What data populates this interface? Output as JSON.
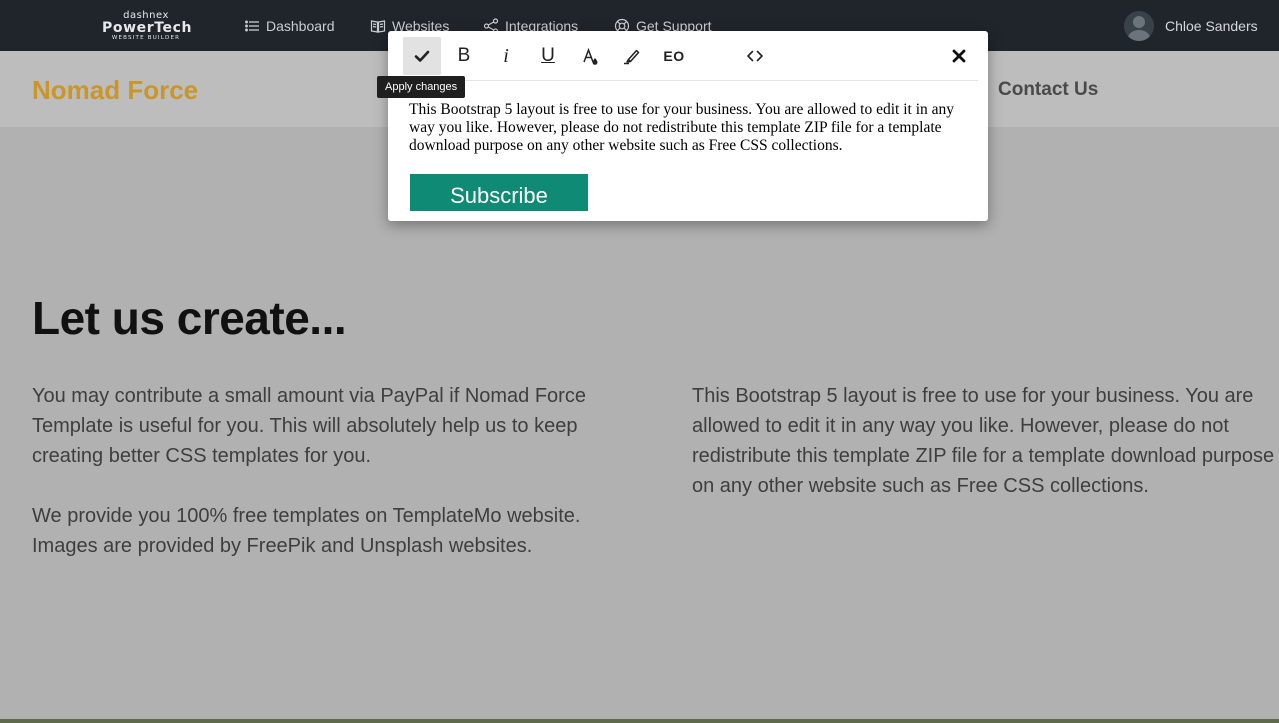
{
  "topbar": {
    "logo": {
      "line1": "dashnex",
      "line2": "PowerTech",
      "line3": "WEBSITE BUILDER"
    },
    "nav": [
      {
        "label": "Dashboard",
        "icon": "list-icon"
      },
      {
        "label": "Websites",
        "icon": "book-icon"
      },
      {
        "label": "Integrations",
        "icon": "share-icon"
      },
      {
        "label": "Get Support",
        "icon": "lifebuoy-icon"
      }
    ],
    "user": {
      "name": "Chloe Sanders"
    }
  },
  "editor": {
    "toolbar": {
      "seo_label": "EO",
      "bold_label": "B",
      "italic_label": "i",
      "underline_label": "U"
    },
    "tooltip": "Apply changes",
    "text": "This Bootstrap 5 layout is free to use for your business. You are allowed to edit it in any way you like. However, please do not redistribute this template ZIP file for a template download purpose on any other website such as Free CSS collections.",
    "button_label": "Subscribe"
  },
  "site": {
    "brand": "Nomad Force",
    "nav_contact": "Contact Us",
    "heading": "Let us create...",
    "para1": "You may contribute a small amount via PayPal if Nomad Force Template is useful for you. This will absolutely help us to keep creating better CSS templates for you.",
    "para2": "We provide you 100% free templates on TemplateMo website. Images are provided by FreePik and Unsplash websites.",
    "para3": "This Bootstrap 5 layout is free to use for your business. You are allowed to edit it in any way you like. However, please do not redistribute this template ZIP file for a template download purpose on any other website such as Free CSS collections."
  },
  "colors": {
    "topbar": "#1f252b",
    "brand": "#c8962a",
    "button": "#0f8a75"
  }
}
